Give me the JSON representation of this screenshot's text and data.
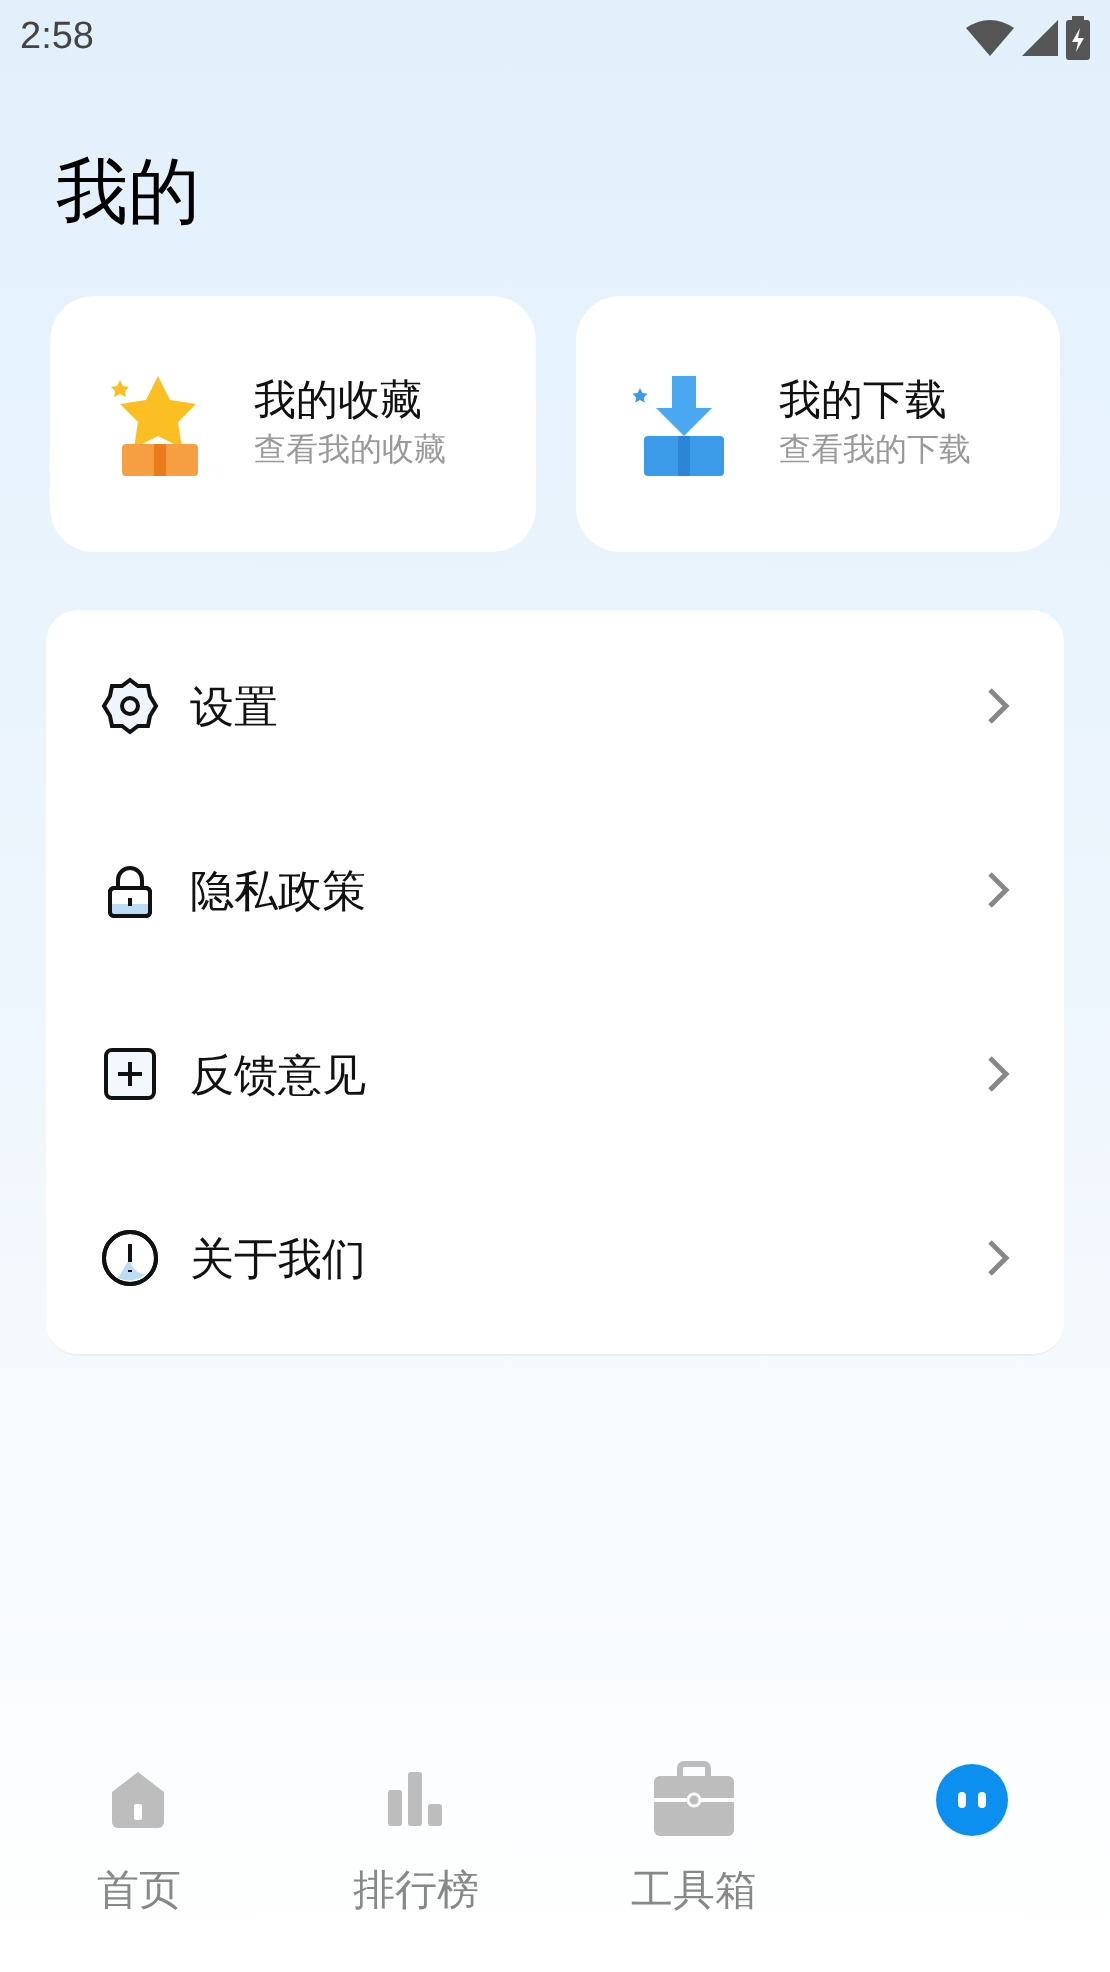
{
  "status_bar": {
    "time": "2:58"
  },
  "title": "我的",
  "quick_cards": [
    {
      "kind": "star",
      "title": "我的收藏",
      "subtitle": "查看我的收藏"
    },
    {
      "kind": "download",
      "title": "我的下载",
      "subtitle": "查看我的下载"
    }
  ],
  "menu": [
    {
      "kind": "settings",
      "label": "设置"
    },
    {
      "kind": "lock",
      "label": "隐私政策"
    },
    {
      "kind": "feedback",
      "label": "反馈意见"
    },
    {
      "kind": "info",
      "label": "关于我们"
    }
  ],
  "tabs": [
    {
      "kind": "home",
      "label": "首页",
      "selected": false
    },
    {
      "kind": "chart",
      "label": "排行榜",
      "selected": false
    },
    {
      "kind": "toolbox",
      "label": "工具箱",
      "selected": false
    },
    {
      "kind": "me",
      "selected": true
    }
  ]
}
